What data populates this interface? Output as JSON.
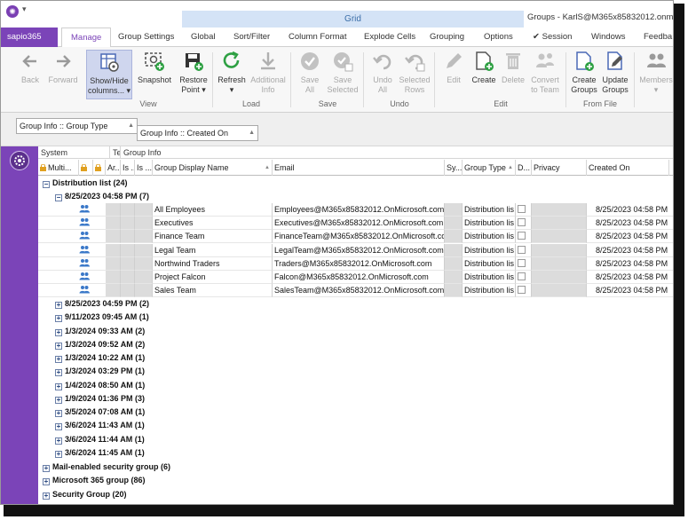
{
  "titlebar": {
    "context_tab": "Grid",
    "window_title": "Groups - KarlS@M365x85832012.onmicr"
  },
  "tabs": {
    "file": "sapio365",
    "items": [
      "Manage",
      "Group Settings",
      "Global",
      "Sort/Filter",
      "Column Format",
      "Explode Cells",
      "Grouping",
      "Options",
      "Session",
      "Windows",
      "Feedba"
    ]
  },
  "ribbon": {
    "buttons": {
      "back": "Back",
      "forward": "Forward",
      "show_hide_1": "Show/Hide",
      "show_hide_2": "columns...",
      "snapshot": "Snapshot",
      "restore_1": "Restore",
      "restore_2": "Point",
      "refresh": "Refresh",
      "additional_1": "Additional",
      "additional_2": "Info",
      "save_all_1": "Save",
      "save_all_2": "All",
      "save_sel_1": "Save",
      "save_sel_2": "Selected",
      "undo_all_1": "Undo",
      "undo_all_2": "All",
      "undo_sel_1": "Selected",
      "undo_sel_2": "Rows",
      "edit": "Edit",
      "create": "Create",
      "delete": "Delete",
      "convert_1": "Convert",
      "convert_2": "to Team",
      "create_groups_1": "Create",
      "create_groups_2": "Groups",
      "update_groups_1": "Update",
      "update_groups_2": "Groups",
      "members": "Members"
    },
    "groups": {
      "view": "View",
      "load": "Load",
      "save": "Save",
      "undo": "Undo",
      "edit": "Edit",
      "from_file": "From File"
    }
  },
  "group_panel": {
    "chip1": "Group Info :: Group Type",
    "chip2": "Group Info :: Created On"
  },
  "grid": {
    "bands": {
      "system": "System",
      "te": "Te...",
      "group_info": "Group Info"
    },
    "columns": {
      "multi": "Multi...",
      "ar": "Ar...",
      "is1": "Is ...",
      "is2": "Is ...",
      "display_name": "Group Display Name",
      "email": "Email",
      "sy": "Sy...",
      "group_type": "Group Type",
      "d": "D...",
      "privacy": "Privacy",
      "created_on": "Created On"
    },
    "top_group": "Distribution list (24)",
    "sub_group": "8/25/2023 04:58 PM (7)",
    "rows": [
      {
        "name": "All Employees",
        "email": "Employees@M365x85832012.OnMicrosoft.com",
        "type": "Distribution lis",
        "created": "8/25/2023 04:58 PM"
      },
      {
        "name": "Executives",
        "email": "Executives@M365x85832012.OnMicrosoft.com",
        "type": "Distribution lis",
        "created": "8/25/2023 04:58 PM"
      },
      {
        "name": "Finance Team",
        "email": "FinanceTeam@M365x85832012.OnMicrosoft.cor",
        "type": "Distribution lis",
        "created": "8/25/2023 04:58 PM"
      },
      {
        "name": "Legal Team",
        "email": "LegalTeam@M365x85832012.OnMicrosoft.com",
        "type": "Distribution lis",
        "created": "8/25/2023 04:58 PM"
      },
      {
        "name": "Northwind Traders",
        "email": "Traders@M365x85832012.OnMicrosoft.com",
        "type": "Distribution lis",
        "created": "8/25/2023 04:58 PM"
      },
      {
        "name": "Project Falcon",
        "email": "Falcon@M365x85832012.OnMicrosoft.com",
        "type": "Distribution lis",
        "created": "8/25/2023 04:58 PM"
      },
      {
        "name": "Sales Team",
        "email": "SalesTeam@M365x85832012.OnMicrosoft.com",
        "type": "Distribution lis",
        "created": "8/25/2023 04:58 PM"
      }
    ],
    "collapsed_dates": [
      "8/25/2023 04:59 PM (2)",
      "9/11/2023 09:45 AM (1)",
      "1/3/2024 09:33 AM (2)",
      "1/3/2024 09:52 AM (2)",
      "1/3/2024 10:22 AM (1)",
      "1/3/2024 03:29 PM (1)",
      "1/4/2024 08:50 AM (1)",
      "1/9/2024 01:36 PM (3)",
      "3/5/2024 07:08 AM (1)",
      "3/6/2024 11:43 AM (1)",
      "3/6/2024 11:44 AM (1)",
      "3/6/2024 11:45 AM (1)"
    ],
    "collapsed_groups": [
      "Mail-enabled security group (6)",
      "Microsoft 365 group (86)",
      "Security Group (20)"
    ]
  },
  "colors": {
    "accent": "#7b44b8",
    "context_tab": "#d4e3f6",
    "icon_green": "#2ea043",
    "icon_gray": "#666666"
  }
}
